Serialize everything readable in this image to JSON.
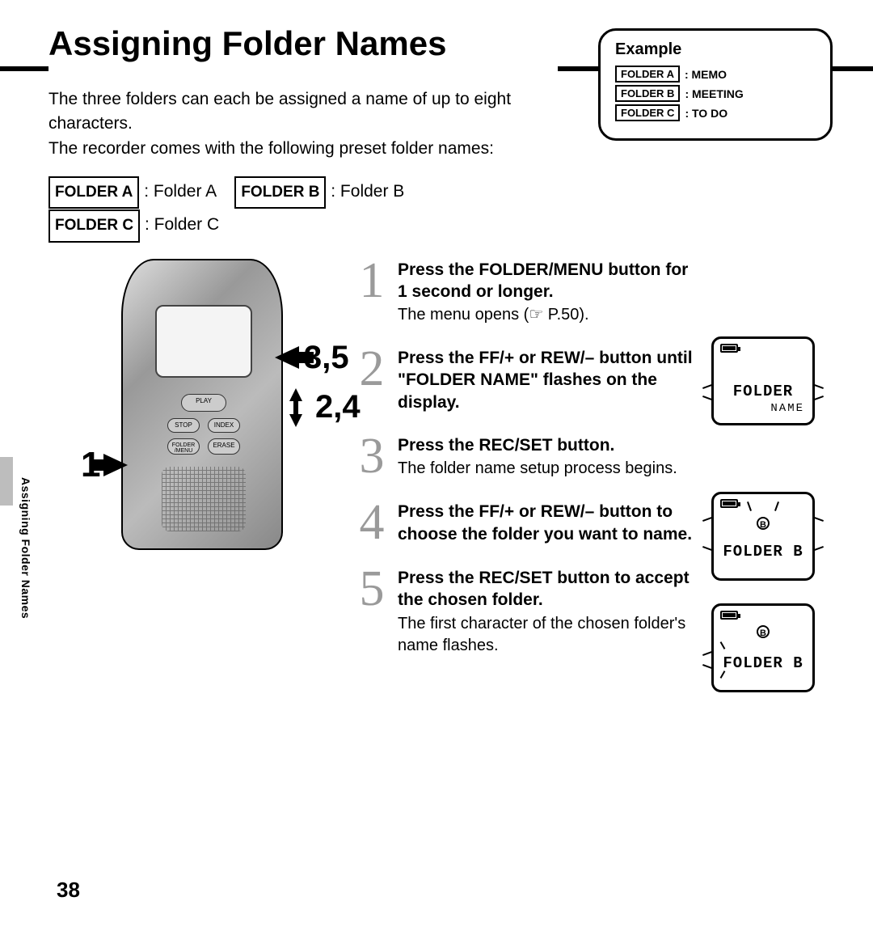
{
  "title": "Assigning Folder Names",
  "intro_line1": "The three folders can each be assigned a name of up to eight characters.",
  "intro_line2": "The recorder comes with the following preset folder names:",
  "presets": {
    "a_label": "FOLDER A",
    "a_value": ": Folder A",
    "b_label": "FOLDER B",
    "b_value": ": Folder B",
    "c_label": "FOLDER C",
    "c_value": ": Folder C"
  },
  "example": {
    "heading": "Example",
    "rows": [
      {
        "label": "FOLDER A",
        "value": ": MEMO"
      },
      {
        "label": "FOLDER B",
        "value": ": MEETING"
      },
      {
        "label": "FOLDER C",
        "value": ": TO DO"
      }
    ]
  },
  "device_buttons": {
    "play": "PLAY",
    "stop": "STOP",
    "index": "INDEX",
    "menu": "FOLDER /MENU",
    "erase": "ERASE"
  },
  "callouts": {
    "one": "1",
    "three_five": "3,5",
    "two_four": "2,4"
  },
  "steps": [
    {
      "num": "1",
      "title": "Press the FOLDER/MENU button for 1 second or longer.",
      "desc": "The menu opens (☞ P.50)."
    },
    {
      "num": "2",
      "title": "Press the FF/+ or REW/– button until \"FOLDER NAME\" flashes on the display.",
      "desc": ""
    },
    {
      "num": "3",
      "title": "Press the REC/SET button.",
      "desc": "The folder name setup process begins."
    },
    {
      "num": "4",
      "title": "Press the FF/+ or REW/– button to choose the folder you want to name.",
      "desc": ""
    },
    {
      "num": "5",
      "title": "Press the REC/SET button to accept the chosen folder.",
      "desc": "The first character of the chosen folder's name flashes."
    }
  ],
  "lcd": {
    "screen1_main": "FOLDER",
    "screen1_sub": "NAME",
    "screen2_main": "FOLDER B",
    "screen2_icon": "B",
    "screen3_main": "FOLDER B",
    "screen3_icon": "B"
  },
  "side_label": "Assigning Folder Names",
  "page_number": "38"
}
